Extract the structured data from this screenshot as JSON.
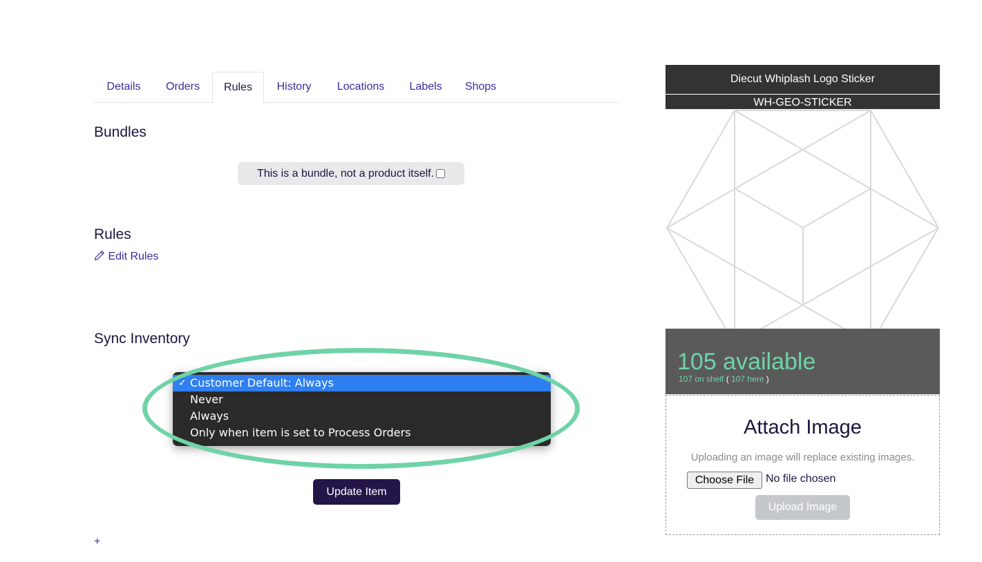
{
  "tabs": [
    {
      "label": "Details",
      "active": false
    },
    {
      "label": "Orders",
      "active": false
    },
    {
      "label": "Rules",
      "active": true
    },
    {
      "label": "History",
      "active": false
    },
    {
      "label": "Locations",
      "active": false
    },
    {
      "label": "Labels",
      "active": false
    },
    {
      "label": "Shops",
      "active": false
    }
  ],
  "bundles": {
    "heading": "Bundles",
    "checkbox_label": "This is a bundle, not a product itself.",
    "checked": false
  },
  "rules": {
    "heading": "Rules",
    "edit_link": "Edit Rules",
    "edit_icon": "pencil-icon"
  },
  "sync": {
    "heading": "Sync Inventory",
    "options": [
      {
        "label": "Customer Default: Always",
        "selected": true
      },
      {
        "label": "Never",
        "selected": false
      },
      {
        "label": "Always",
        "selected": false
      },
      {
        "label": "Only when item is set to Process Orders",
        "selected": false
      }
    ],
    "check_mark": "✓"
  },
  "actions": {
    "update_label": "Update Item",
    "add_label": "+"
  },
  "product": {
    "title": "Diecut Whiplash Logo Sticker",
    "sku": "WH-GEO-STICKER",
    "available_text": "105 available",
    "on_shelf_text": "107 on shelf",
    "here_text": "107 here",
    "paren_open": "(",
    "paren_close": ")"
  },
  "attach": {
    "title": "Attach Image",
    "note": "Uploading an image will replace existing images.",
    "choose_label": "Choose File",
    "no_file": "No file chosen",
    "upload_label": "Upload Image"
  },
  "colors": {
    "accent": "#3d2a9c",
    "brand_dark": "#241548",
    "highlight": "#6fd3a7",
    "selected_option": "#2f7ff0"
  }
}
